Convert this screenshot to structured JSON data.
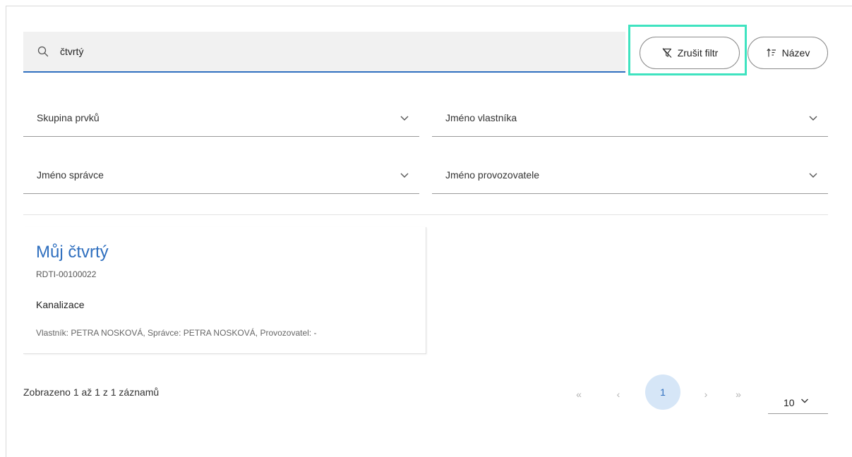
{
  "search": {
    "value": "čtvrtý",
    "placeholder": ""
  },
  "toolbar": {
    "clear_filter_label": "Zrušit filtr",
    "sort_label": "Název"
  },
  "filters": {
    "element_group": "Skupina prvků",
    "owner_name": "Jméno vlastníka",
    "manager_name": "Jméno správce",
    "operator_name": "Jméno provozovatele"
  },
  "results": [
    {
      "title": "Můj čtvrtý",
      "code": "RDTI-00100022",
      "type": "Kanalizace",
      "meta": "Vlastník: PETRA NOSKOVÁ, Správce: PETRA NOSKOVÁ, Provozovatel: -"
    }
  ],
  "pagination": {
    "summary": "Zobrazeno 1 až 1 z 1 záznamů",
    "first": "«",
    "prev": "‹",
    "current": "1",
    "next": "›",
    "last": "»",
    "per_page": "10"
  },
  "colors": {
    "accent": "#2f6fbf",
    "highlight": "#3fe3c0",
    "current_page_bg": "#d6e6f7"
  }
}
